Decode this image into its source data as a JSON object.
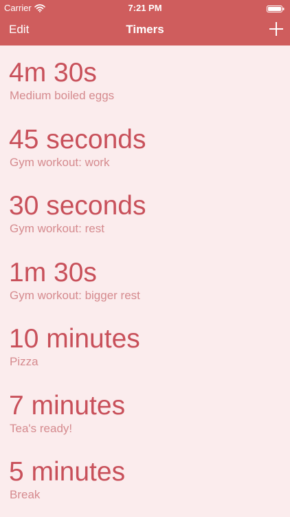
{
  "status_bar": {
    "carrier": "Carrier",
    "time": "7:21 PM",
    "wifi_icon": "wifi-icon",
    "battery_icon": "battery-icon"
  },
  "nav": {
    "edit_label": "Edit",
    "title": "Timers",
    "add_icon": "plus-icon"
  },
  "timers": [
    {
      "duration": "4m 30s",
      "label": "Medium boiled eggs"
    },
    {
      "duration": "45 seconds",
      "label": "Gym workout: work"
    },
    {
      "duration": "30 seconds",
      "label": "Gym workout: rest"
    },
    {
      "duration": "1m 30s",
      "label": "Gym workout: bigger rest"
    },
    {
      "duration": "10 minutes",
      "label": "Pizza"
    },
    {
      "duration": "7 minutes",
      "label": "Tea's ready!"
    },
    {
      "duration": "5 minutes",
      "label": "Break"
    }
  ],
  "colors": {
    "nav_background": "#cf5d5d",
    "page_background": "#fbeced",
    "duration_text": "#c8505a",
    "label_text": "#d58a8e"
  }
}
